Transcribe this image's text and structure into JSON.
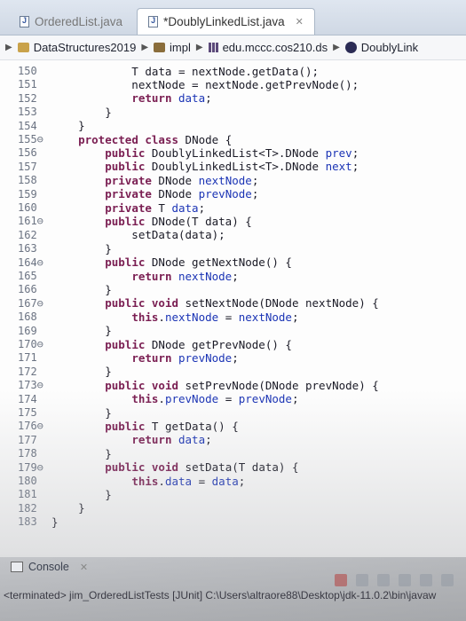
{
  "tabs": [
    {
      "label": "OrderedList.java",
      "active": false
    },
    {
      "label": "*DoublyLinkedList.java",
      "active": true
    }
  ],
  "breadcrumb": [
    "DataStructures2019",
    "impl",
    "edu.mccc.cos210.ds",
    "DoublyLink"
  ],
  "editor": {
    "lines": [
      {
        "n": "150",
        "text": "            T data = nextNode.getData();"
      },
      {
        "n": "151",
        "text": "            nextNode = nextNode.getPrevNode();"
      },
      {
        "n": "152",
        "text": "            return data;"
      },
      {
        "n": "153",
        "text": "        }"
      },
      {
        "n": "154",
        "text": "    }"
      },
      {
        "n": "155⊖",
        "text": "    protected class DNode {"
      },
      {
        "n": "156",
        "text": "        public DoublyLinkedList<T>.DNode prev;"
      },
      {
        "n": "157",
        "text": "        public DoublyLinkedList<T>.DNode next;"
      },
      {
        "n": "158",
        "text": "        private DNode nextNode;"
      },
      {
        "n": "159",
        "text": "        private DNode prevNode;"
      },
      {
        "n": "160",
        "text": "        private T data;"
      },
      {
        "n": "161⊖",
        "text": "        public DNode(T data) {"
      },
      {
        "n": "162",
        "text": "            setData(data);"
      },
      {
        "n": "163",
        "text": "        }"
      },
      {
        "n": "164⊖",
        "text": "        public DNode getNextNode() {"
      },
      {
        "n": "165",
        "text": "            return nextNode;"
      },
      {
        "n": "166",
        "text": "        }"
      },
      {
        "n": "167⊖",
        "text": "        public void setNextNode(DNode nextNode) {"
      },
      {
        "n": "168",
        "text": "            this.nextNode = nextNode;"
      },
      {
        "n": "169",
        "text": "        }"
      },
      {
        "n": "170⊖",
        "text": "        public DNode getPrevNode() {"
      },
      {
        "n": "171",
        "text": "            return prevNode;"
      },
      {
        "n": "172",
        "text": "        }"
      },
      {
        "n": "173⊖",
        "text": "        public void setPrevNode(DNode prevNode) {"
      },
      {
        "n": "174",
        "text": "            this.prevNode = prevNode;"
      },
      {
        "n": "175",
        "text": "        }"
      },
      {
        "n": "176⊖",
        "text": "        public T getData() {"
      },
      {
        "n": "177",
        "text": "            return data;"
      },
      {
        "n": "178",
        "text": "        }"
      },
      {
        "n": "179⊖",
        "text": "        public void setData(T data) {"
      },
      {
        "n": "180",
        "text": "            this.data = data;"
      },
      {
        "n": "181",
        "text": "        }"
      },
      {
        "n": "182",
        "text": "    }"
      },
      {
        "n": "183",
        "text": "}"
      }
    ]
  },
  "console": {
    "label": "Console",
    "status": "<terminated> jim_OrderedListTests [JUnit] C:\\Users\\altraore88\\Desktop\\jdk-11.0.2\\bin\\javaw"
  }
}
